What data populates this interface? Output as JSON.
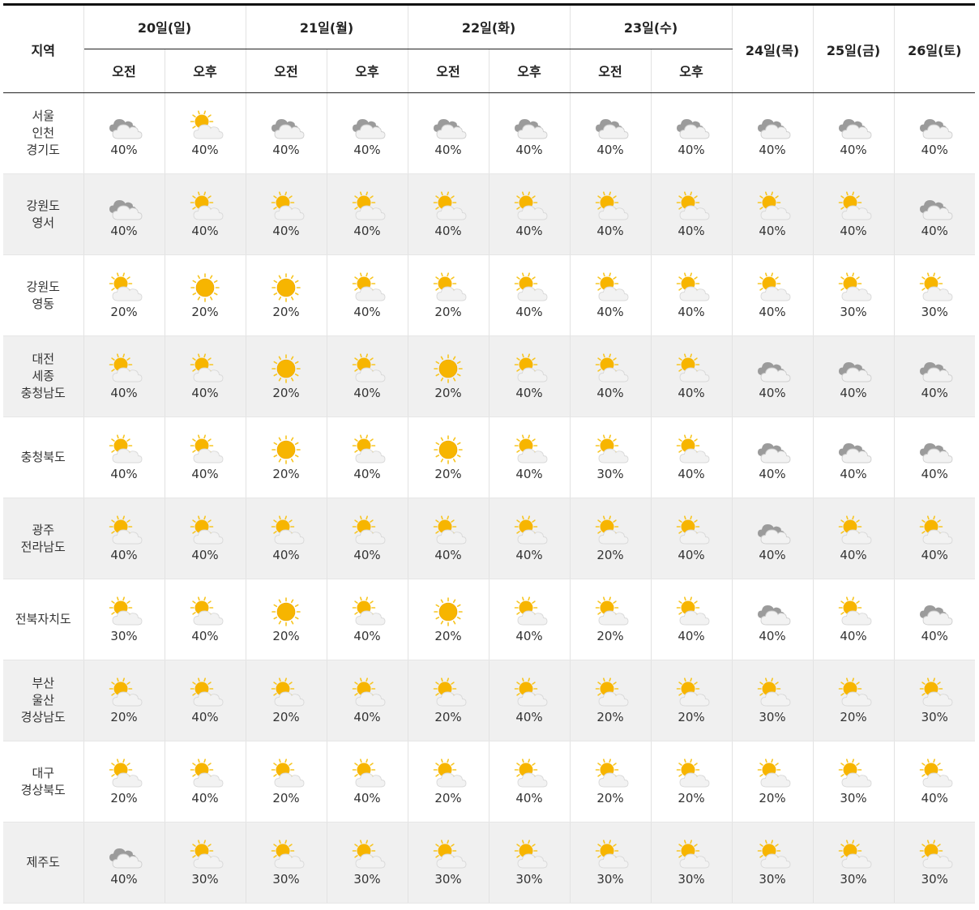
{
  "header": {
    "region_label": "지역",
    "days": [
      {
        "label": "20일(일)",
        "split": true
      },
      {
        "label": "21일(월)",
        "split": true
      },
      {
        "label": "22일(화)",
        "split": true
      },
      {
        "label": "23일(수)",
        "split": true
      },
      {
        "label": "24일(목)",
        "split": false
      },
      {
        "label": "25일(금)",
        "split": false
      },
      {
        "label": "26일(토)",
        "split": false
      }
    ],
    "am_label": "오전",
    "pm_label": "오후"
  },
  "rows": [
    {
      "region": [
        "서울",
        "인천",
        "경기도"
      ],
      "cells": [
        [
          "cloudy",
          "40%"
        ],
        [
          "partly",
          "40%"
        ],
        [
          "cloudy",
          "40%"
        ],
        [
          "cloudy",
          "40%"
        ],
        [
          "cloudy",
          "40%"
        ],
        [
          "cloudy",
          "40%"
        ],
        [
          "cloudy",
          "40%"
        ],
        [
          "cloudy",
          "40%"
        ],
        [
          "cloudy",
          "40%"
        ],
        [
          "cloudy",
          "40%"
        ],
        [
          "cloudy",
          "40%"
        ]
      ]
    },
    {
      "region": [
        "강원도",
        "영서"
      ],
      "cells": [
        [
          "cloudy",
          "40%"
        ],
        [
          "partly",
          "40%"
        ],
        [
          "partly",
          "40%"
        ],
        [
          "partly",
          "40%"
        ],
        [
          "partly",
          "40%"
        ],
        [
          "partly",
          "40%"
        ],
        [
          "partly",
          "40%"
        ],
        [
          "partly",
          "40%"
        ],
        [
          "partly",
          "40%"
        ],
        [
          "partly",
          "40%"
        ],
        [
          "cloudy",
          "40%"
        ]
      ]
    },
    {
      "region": [
        "강원도",
        "영동"
      ],
      "cells": [
        [
          "partly",
          "20%"
        ],
        [
          "sunny",
          "20%"
        ],
        [
          "sunny",
          "20%"
        ],
        [
          "partly",
          "40%"
        ],
        [
          "partly",
          "20%"
        ],
        [
          "partly",
          "40%"
        ],
        [
          "partly",
          "40%"
        ],
        [
          "partly",
          "40%"
        ],
        [
          "partly",
          "40%"
        ],
        [
          "partly",
          "30%"
        ],
        [
          "partly",
          "30%"
        ]
      ]
    },
    {
      "region": [
        "대전",
        "세종",
        "충청남도"
      ],
      "cells": [
        [
          "partly",
          "40%"
        ],
        [
          "partly",
          "40%"
        ],
        [
          "sunny",
          "20%"
        ],
        [
          "partly",
          "40%"
        ],
        [
          "sunny",
          "20%"
        ],
        [
          "partly",
          "40%"
        ],
        [
          "partly",
          "40%"
        ],
        [
          "partly",
          "40%"
        ],
        [
          "cloudy",
          "40%"
        ],
        [
          "cloudy",
          "40%"
        ],
        [
          "cloudy",
          "40%"
        ]
      ]
    },
    {
      "region": [
        "충청북도"
      ],
      "cells": [
        [
          "partly",
          "40%"
        ],
        [
          "partly",
          "40%"
        ],
        [
          "sunny",
          "20%"
        ],
        [
          "partly",
          "40%"
        ],
        [
          "sunny",
          "20%"
        ],
        [
          "partly",
          "40%"
        ],
        [
          "partly",
          "30%"
        ],
        [
          "partly",
          "40%"
        ],
        [
          "cloudy",
          "40%"
        ],
        [
          "cloudy",
          "40%"
        ],
        [
          "cloudy",
          "40%"
        ]
      ]
    },
    {
      "region": [
        "광주",
        "전라남도"
      ],
      "cells": [
        [
          "partly",
          "40%"
        ],
        [
          "partly",
          "40%"
        ],
        [
          "partly",
          "40%"
        ],
        [
          "partly",
          "40%"
        ],
        [
          "partly",
          "40%"
        ],
        [
          "partly",
          "40%"
        ],
        [
          "partly",
          "20%"
        ],
        [
          "partly",
          "40%"
        ],
        [
          "cloudy",
          "40%"
        ],
        [
          "partly",
          "40%"
        ],
        [
          "partly",
          "40%"
        ]
      ]
    },
    {
      "region": [
        "전북자치도"
      ],
      "cells": [
        [
          "partly",
          "30%"
        ],
        [
          "partly",
          "40%"
        ],
        [
          "sunny",
          "20%"
        ],
        [
          "partly",
          "40%"
        ],
        [
          "sunny",
          "20%"
        ],
        [
          "partly",
          "40%"
        ],
        [
          "partly",
          "20%"
        ],
        [
          "partly",
          "40%"
        ],
        [
          "cloudy",
          "40%"
        ],
        [
          "partly",
          "40%"
        ],
        [
          "cloudy",
          "40%"
        ]
      ]
    },
    {
      "region": [
        "부산",
        "울산",
        "경상남도"
      ],
      "cells": [
        [
          "partly",
          "20%"
        ],
        [
          "partly",
          "40%"
        ],
        [
          "partly",
          "20%"
        ],
        [
          "partly",
          "40%"
        ],
        [
          "partly",
          "20%"
        ],
        [
          "partly",
          "40%"
        ],
        [
          "partly",
          "20%"
        ],
        [
          "partly",
          "20%"
        ],
        [
          "partly",
          "30%"
        ],
        [
          "partly",
          "20%"
        ],
        [
          "partly",
          "30%"
        ]
      ]
    },
    {
      "region": [
        "대구",
        "경상북도"
      ],
      "cells": [
        [
          "partly",
          "20%"
        ],
        [
          "partly",
          "40%"
        ],
        [
          "partly",
          "20%"
        ],
        [
          "partly",
          "40%"
        ],
        [
          "partly",
          "20%"
        ],
        [
          "partly",
          "40%"
        ],
        [
          "partly",
          "20%"
        ],
        [
          "partly",
          "20%"
        ],
        [
          "partly",
          "20%"
        ],
        [
          "partly",
          "30%"
        ],
        [
          "partly",
          "40%"
        ]
      ]
    },
    {
      "region": [
        "제주도"
      ],
      "cells": [
        [
          "cloudy",
          "40%"
        ],
        [
          "partly",
          "30%"
        ],
        [
          "partly",
          "30%"
        ],
        [
          "partly",
          "30%"
        ],
        [
          "partly",
          "30%"
        ],
        [
          "partly",
          "30%"
        ],
        [
          "partly",
          "30%"
        ],
        [
          "partly",
          "30%"
        ],
        [
          "partly",
          "30%"
        ],
        [
          "partly",
          "30%"
        ],
        [
          "partly",
          "30%"
        ]
      ]
    }
  ],
  "icons": {
    "sunny": "sun-icon",
    "partly": "partly-cloudy-icon",
    "cloudy": "cloudy-icon"
  },
  "colors": {
    "sun": "#F7B500",
    "sun_ray": "#F7C520",
    "cloud_light": "#F2F2F2",
    "cloud_dark": "#9B9B9B",
    "alt_row": "#F0F0F0"
  }
}
